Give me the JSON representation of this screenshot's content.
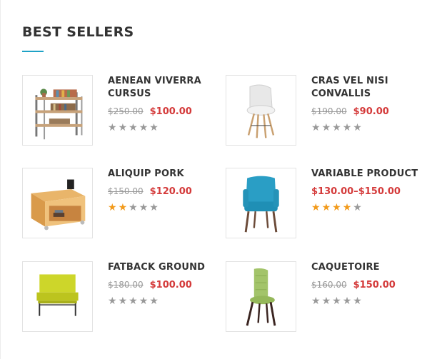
{
  "section": {
    "title": "BEST SELLERS",
    "accent_color": "#1ea2c6"
  },
  "colors": {
    "sale_price": "#d43a3a",
    "old_price": "#999999",
    "star_on": "#f29a1a",
    "star_off": "#999999"
  },
  "products": [
    {
      "name": "AENEAN VIVERRA CURSUS",
      "old_price": "$250.00",
      "price": "$100.00",
      "rating": 0,
      "image": "shelf-icon"
    },
    {
      "name": "CRAS VEL NISI CONVALLIS",
      "old_price": "$190.00",
      "price": "$90.00",
      "rating": 0,
      "image": "white-chair-icon"
    },
    {
      "name": "ALIQUIP PORK",
      "old_price": "$150.00",
      "price": "$120.00",
      "rating": 2,
      "image": "side-table-icon"
    },
    {
      "name": "VARIABLE PRODUCT",
      "price_range": "$130.00–$150.00",
      "rating": 3.5,
      "image": "blue-armchair-icon"
    },
    {
      "name": "FATBACK GROUND",
      "old_price": "$180.00",
      "price": "$100.00",
      "rating": 0,
      "image": "yellow-bench-icon"
    },
    {
      "name": "CAQUETOIRE",
      "old_price": "$160.00",
      "price": "$150.00",
      "rating": 0,
      "image": "green-chair-icon"
    }
  ]
}
